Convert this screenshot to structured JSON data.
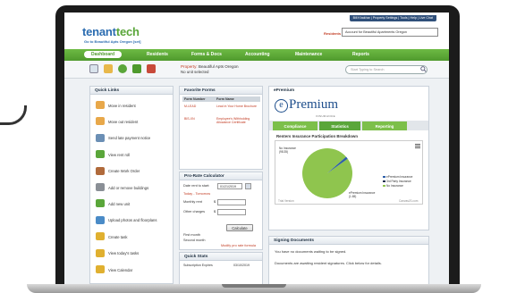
{
  "header": {
    "logo_main": "tenant",
    "logo_accent": "tech",
    "logo_sub": "Go to Beautiful Apts Oregon [set]",
    "util_links": "Bill Khakhar | Property Settings | Tools | Help | Live Chat",
    "residents_label": "Residents",
    "account_value": "Account for Beautiful Apartments Oregon"
  },
  "nav": {
    "items": [
      "Dashboard",
      "Residents",
      "Forms & Docs",
      "Accounting",
      "Maintenance",
      "Reports"
    ]
  },
  "toolbar": {
    "property_label": "Property:",
    "property_value": "Beautiful Apts Oregon",
    "unit_status": "No unit selected",
    "search_placeholder": "Start Typing to Search"
  },
  "quick_links": {
    "title": "Quick Links",
    "items": [
      {
        "label": "Move in resident",
        "color": "#e8a84a"
      },
      {
        "label": "Move out resident",
        "color": "#e8a84a"
      },
      {
        "label": "Send late payment notice",
        "color": "#6b8fb5"
      },
      {
        "label": "View rent roll",
        "color": "#5aa63a"
      },
      {
        "label": "Create Work Order",
        "color": "#b06a3b"
      },
      {
        "label": "Add or remove buildings",
        "color": "#8a8f96"
      },
      {
        "label": "Add new unit",
        "color": "#5aa63a"
      },
      {
        "label": "Upload photos and floorplans",
        "color": "#4a8bc7"
      },
      {
        "label": "Create task",
        "color": "#e0b030"
      },
      {
        "label": "View today's tasks",
        "color": "#e0b030"
      },
      {
        "label": "View Calendar",
        "color": "#e0b030"
      }
    ]
  },
  "favorite_forms": {
    "title": "Favorite Forms",
    "col_number": "Form Number",
    "col_name": "Form Name",
    "rows": [
      {
        "number": "M-LEAD",
        "name": "Lead in Your Home Brochure"
      },
      {
        "number": "BIS-XN",
        "name": "Employee's Withholding Allowance Certificate"
      }
    ]
  },
  "prorate": {
    "title": "Pro-Rate Calculator",
    "date_label": "Date rent to start:",
    "date_value": "01/21/2019",
    "today_link": "Today",
    "tomorrow_link": "Tomorrow",
    "monthly_label": "Monthly rent",
    "other_label": "Other charges",
    "currency": "$",
    "calculate_label": "Calculate",
    "first_month_label": "First month",
    "second_month_label": "Second month",
    "modify_link": "Modify pro rate formula"
  },
  "quick_stats": {
    "title": "Quick Stats",
    "row_label": "Subscription Expires",
    "row_value": "03/10/2019"
  },
  "epremium": {
    "title": "ePremium",
    "brand": "Premium",
    "brand_sub": "INSURANCE",
    "tabs": [
      "Compliance",
      "Statistics",
      "Reporting"
    ],
    "chart_title": "Renters Insurance Participation Breakdown"
  },
  "chart_data": {
    "type": "pie",
    "series": [
      {
        "name": "No Insurance",
        "values": [
          98.35
        ],
        "color": "#8fc54e"
      },
      {
        "name": "ePremium Insurance",
        "values": [
          1.65
        ],
        "color": "#2e5fa8"
      },
      {
        "name": "3rd Party Insurance",
        "values": [
          0.0
        ],
        "color": "#1f3050"
      }
    ],
    "legend_items": [
      "ePremium Insurance",
      "3rd Party Insurance",
      "No Insurance"
    ],
    "slice_labels": [
      {
        "text": "No Insurance",
        "pct": "(98.35)"
      },
      {
        "text": "ePremium Insurance",
        "pct": "(1.65)"
      }
    ],
    "footer_left": "Trial Version",
    "footer_right": "CanvasJS.com",
    "legend_placement": "right"
  },
  "signing_docs": {
    "title": "Signing Documents",
    "line1": "You have no documents waiting to be signed.",
    "line2": "Documents are awaiting resident signatures. Click below for details."
  }
}
